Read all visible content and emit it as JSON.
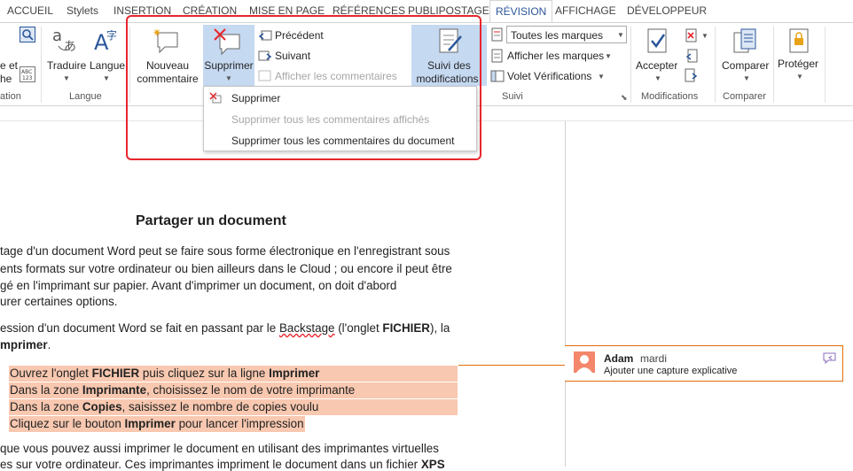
{
  "tabs": [
    {
      "label": "ACCUEIL"
    },
    {
      "label": "Stylets"
    },
    {
      "label": "INSERTION"
    },
    {
      "label": "CRÉATION"
    },
    {
      "label": "MISE EN PAGE"
    },
    {
      "label": "RÉFÉRENCES"
    },
    {
      "label": "PUBLIPOSTAGE"
    },
    {
      "label": "RÉVISION",
      "active": true
    },
    {
      "label": "AFFICHAGE"
    },
    {
      "label": "DÉVELOPPEUR"
    }
  ],
  "ribbon": {
    "proofing_partial": {
      "line1": "e et",
      "line2": "he",
      "group": "ation"
    },
    "langue": {
      "translate": "Traduire",
      "language": "Langue",
      "group": "Langue"
    },
    "comments": {
      "new_line1": "Nouveau",
      "new_line2": "commentaire",
      "delete": "Supprimer",
      "previous": "Précédent",
      "next": "Suivant",
      "show": "Afficher les commentaires"
    },
    "suivi": {
      "track_line1": "Suivi des",
      "track_line2": "modifications",
      "markup_select": "Toutes les marques",
      "show_markup": "Afficher les marques",
      "pane": "Volet Vérifications",
      "group": "Suivi"
    },
    "modifications": {
      "accept": "Accepter",
      "group": "Modifications"
    },
    "comparer": {
      "compare": "Comparer",
      "group": "Comparer"
    },
    "proteger": {
      "protect": "Protéger"
    }
  },
  "delete_menu": {
    "item1": "Supprimer",
    "item2": "Supprimer tous les commentaires affichés",
    "item3": "Supprimer tous les commentaires du document"
  },
  "document": {
    "title": "Partager un document",
    "p1": [
      "tage d'un document Word peut se faire sous forme électronique en l'enregistrant sous",
      "ents formats sur votre ordinateur ou bien ailleurs dans le Cloud ; ou encore il peut être",
      "gé en l'imprimant sur papier. Avant d'imprimer un document, on doit d'abord",
      "urer certaines options."
    ],
    "p2_l1_a": "ession d'un document Word se fait en passant par le ",
    "p2_l1_b": "Backstage",
    "p2_l1_c": " (l'onglet ",
    "p2_l1_d": "FICHIER",
    "p2_l1_e": "), la",
    "p2_l2_a": "mprimer",
    "p2_l2_b": ".",
    "steps": [
      {
        "a": "Ouvrez l'onglet ",
        "b": "FICHIER",
        "c": " puis cliquez sur la ligne ",
        "d": "Imprimer",
        "e": ""
      },
      {
        "a": "Dans la zone ",
        "b": "Imprimante",
        "c": ", choisissez le nom de votre imprimante",
        "d": "",
        "e": ""
      },
      {
        "a": "Dans la zone ",
        "b": "Copies",
        "c": ", saisissez le nombre de copies voulu",
        "d": "",
        "e": ""
      },
      {
        "a": "Cliquez sur le bouton ",
        "b": "Imprimer",
        "c": " pour lancer l'impression",
        "d": "",
        "e": ""
      }
    ],
    "p3_l1": "que vous pouvez aussi imprimer le document en utilisant des imprimantes virtuelles",
    "p3_l2_a": "es sur votre ordinateur. Ces imprimantes impriment le document dans un fichier ",
    "p3_l2_b": "XPS"
  },
  "comment": {
    "author": "Adam",
    "time": "mardi",
    "text": "Ajouter une capture explicative"
  },
  "colors": {
    "accent": "#2b579a",
    "highlight_annotation": "#e8262d",
    "comment_line": "#e36c0a",
    "selection_fill": "#f8c8b0"
  }
}
